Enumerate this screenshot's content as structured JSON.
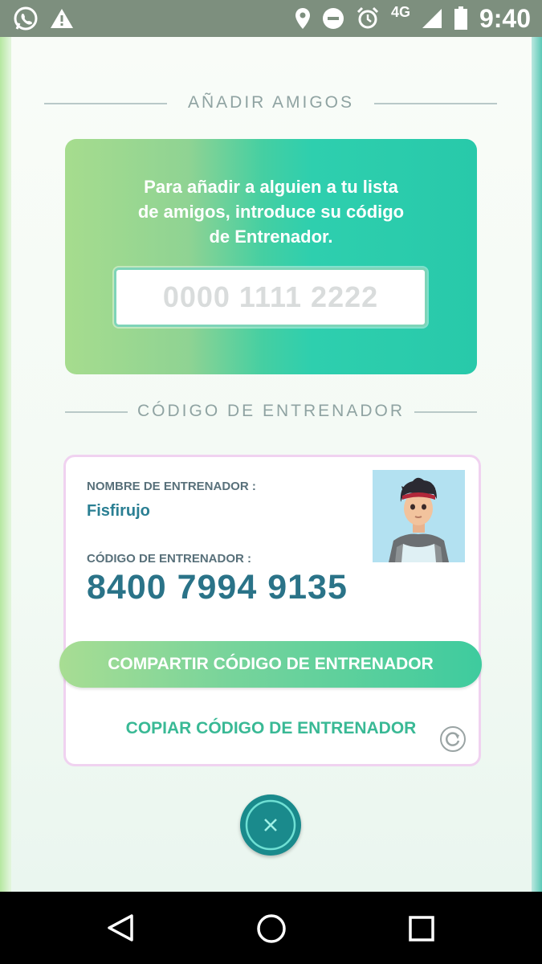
{
  "status_bar": {
    "left_icons": [
      "whatsapp-icon",
      "warning-icon"
    ],
    "right_icons": [
      "location-icon",
      "do-not-disturb-icon",
      "alarm-icon"
    ],
    "network": "4G",
    "time": "9:40"
  },
  "add_friends": {
    "title": "AÑADIR AMIGOS",
    "description_lines": [
      "Para añadir a alguien a tu lista",
      "de amigos, introduce su código",
      "de Entrenador."
    ],
    "input_placeholder": "0000 1111 2222",
    "input_value": ""
  },
  "trainer_code_section": {
    "title": "CÓDIGO DE ENTRENADOR",
    "name_label": "NOMBRE DE ENTRENADOR :",
    "name_value": "Fisfirujo",
    "code_label": "CÓDIGO DE ENTRENADOR :",
    "code_value": "8400 7994 9135",
    "share_button": "COMPARTIR CÓDIGO DE ENTRENADOR",
    "copy_link": "COPIAR CÓDIGO DE ENTRENADOR"
  },
  "icons": {
    "refresh": "refresh-icon",
    "close": "close-icon",
    "nav": [
      "back-icon",
      "home-icon",
      "recents-icon"
    ]
  },
  "colors": {
    "accent_teal": "#2ecfae",
    "accent_green": "#a6dc8e",
    "code_text": "#2a7388",
    "close_button": "#1a8a8c"
  }
}
